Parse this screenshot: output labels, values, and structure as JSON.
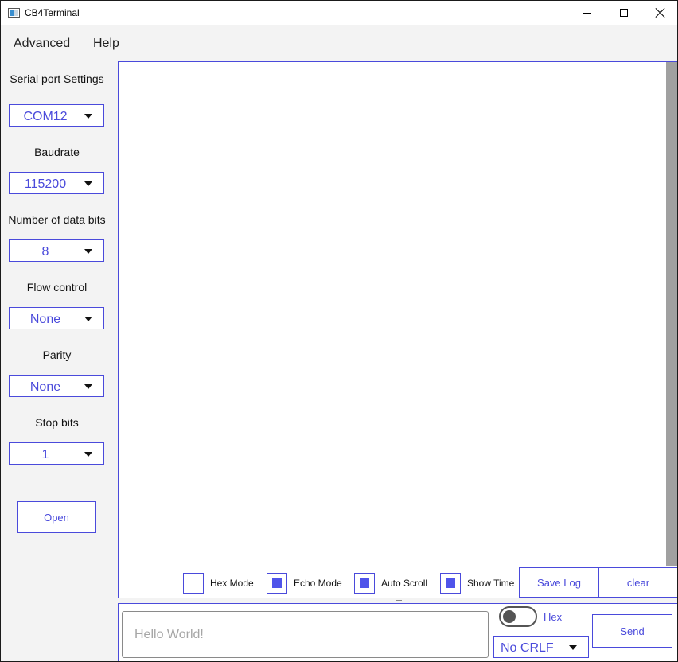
{
  "window": {
    "title": "CB4Terminal",
    "app_icon": "terminal-app-icon",
    "controls": [
      "minimize-icon",
      "maximize-icon",
      "close-icon"
    ]
  },
  "menu": {
    "advanced": "Advanced",
    "help": "Help"
  },
  "settings": {
    "heading": "Serial port Settings",
    "port": {
      "value": "COM12"
    },
    "baudrate": {
      "label": "Baudrate",
      "value": "115200"
    },
    "data_bits": {
      "label": "Number of data bits",
      "value": "8"
    },
    "flow_control": {
      "label": "Flow control",
      "value": "None"
    },
    "parity": {
      "label": "Parity",
      "value": "None"
    },
    "stop_bits": {
      "label": "Stop bits",
      "value": "1"
    },
    "open_label": "Open"
  },
  "log": {
    "content": "",
    "options": {
      "hex_mode": {
        "label": "Hex Mode",
        "checked": false
      },
      "echo_mode": {
        "label": "Echo Mode",
        "checked": true
      },
      "auto_scroll": {
        "label": "Auto Scroll",
        "checked": true
      },
      "show_time": {
        "label": "Show Time",
        "checked": true
      }
    },
    "save_label": "Save Log",
    "clear_label": "clear"
  },
  "send": {
    "placeholder": "Hello World!",
    "value": "",
    "hex_toggle": {
      "label": "Hex",
      "on": false
    },
    "line_ending": "No CRLF",
    "send_label": "Send"
  },
  "colors": {
    "accent": "#4a4adb",
    "checkbox_fill": "#4f54ea",
    "scrollbar": "#a0a0a0",
    "panel_bg": "#f3f3f3"
  }
}
